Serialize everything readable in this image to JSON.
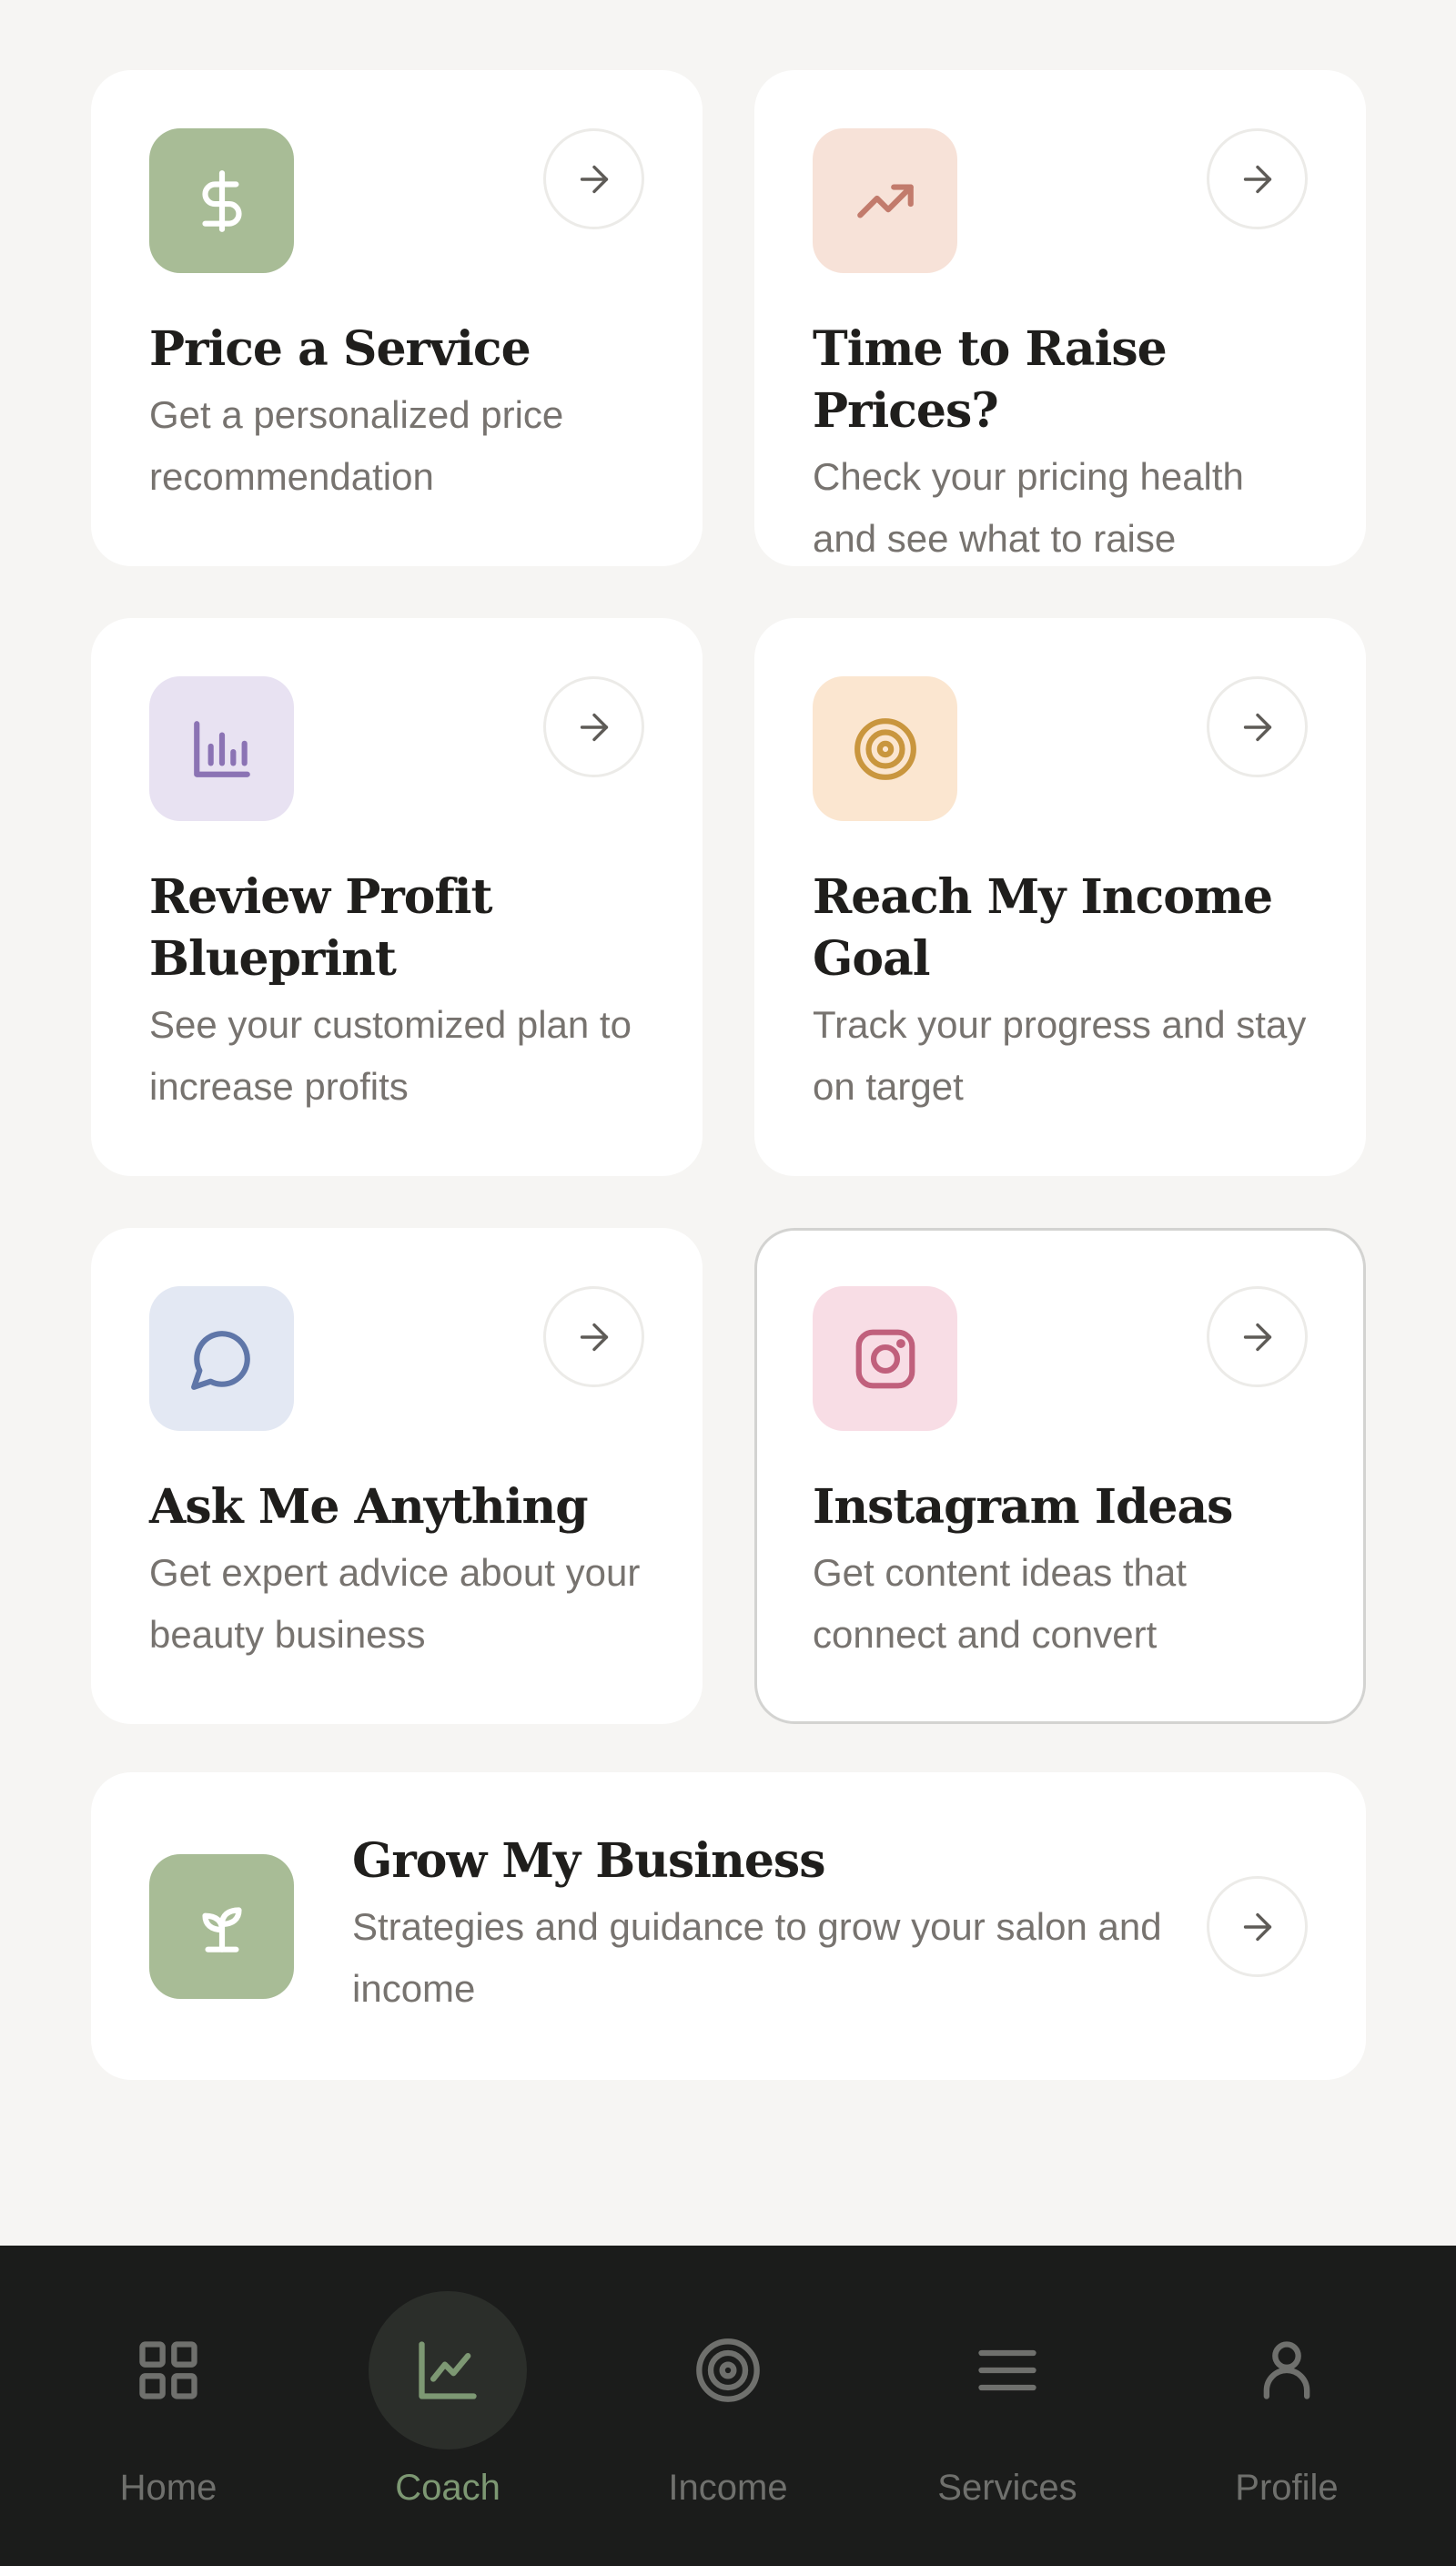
{
  "colors": {
    "background": "#f6f5f3",
    "card": "#ffffff",
    "nav_background": "#1b1c1b",
    "nav_active": "#7d9873",
    "nav_inactive": "#6f706d"
  },
  "cards": [
    {
      "title": "Price a Service",
      "description": "Get a personalized price recommendation",
      "icon": "dollar-icon",
      "tile_color": "#a8bc96",
      "icon_color": "#ffffff"
    },
    {
      "title": "Time to Raise Prices?",
      "description": "Check your pricing health and see what to raise",
      "icon": "trending-up-icon",
      "tile_color": "#f7e2d8",
      "icon_color": "#c27b6c"
    },
    {
      "title": "Review Profit Blueprint",
      "description": "See your customized plan to increase profits",
      "icon": "bar-chart-icon",
      "tile_color": "#e8e2f2",
      "icon_color": "#8b73b4"
    },
    {
      "title": "Reach My Income Goal",
      "description": "Track your progress and stay on target",
      "icon": "target-icon",
      "tile_color": "#fbe6d0",
      "icon_color": "#c9963e"
    },
    {
      "title": "Ask Me Anything",
      "description": "Get expert advice about your beauty business",
      "icon": "chat-bubble-icon",
      "tile_color": "#e3e8f3",
      "icon_color": "#5f76a8"
    },
    {
      "title": "Instagram Ideas",
      "description": "Get content ideas that connect and convert",
      "icon": "instagram-icon",
      "tile_color": "#f8dde5",
      "icon_color": "#c0607c"
    }
  ],
  "wide_card": {
    "title": "Grow My Business",
    "description": "Strategies and guidance to grow your salon and income",
    "icon": "sprout-icon",
    "tile_color": "#a8bc96",
    "icon_color": "#ffffff"
  },
  "nav": [
    {
      "label": "Home",
      "icon": "grid-icon",
      "active": false
    },
    {
      "label": "Coach",
      "icon": "chart-line-icon",
      "active": true
    },
    {
      "label": "Income",
      "icon": "target-icon",
      "active": false
    },
    {
      "label": "Services",
      "icon": "menu-icon",
      "active": false
    },
    {
      "label": "Profile",
      "icon": "user-icon",
      "active": false
    }
  ]
}
